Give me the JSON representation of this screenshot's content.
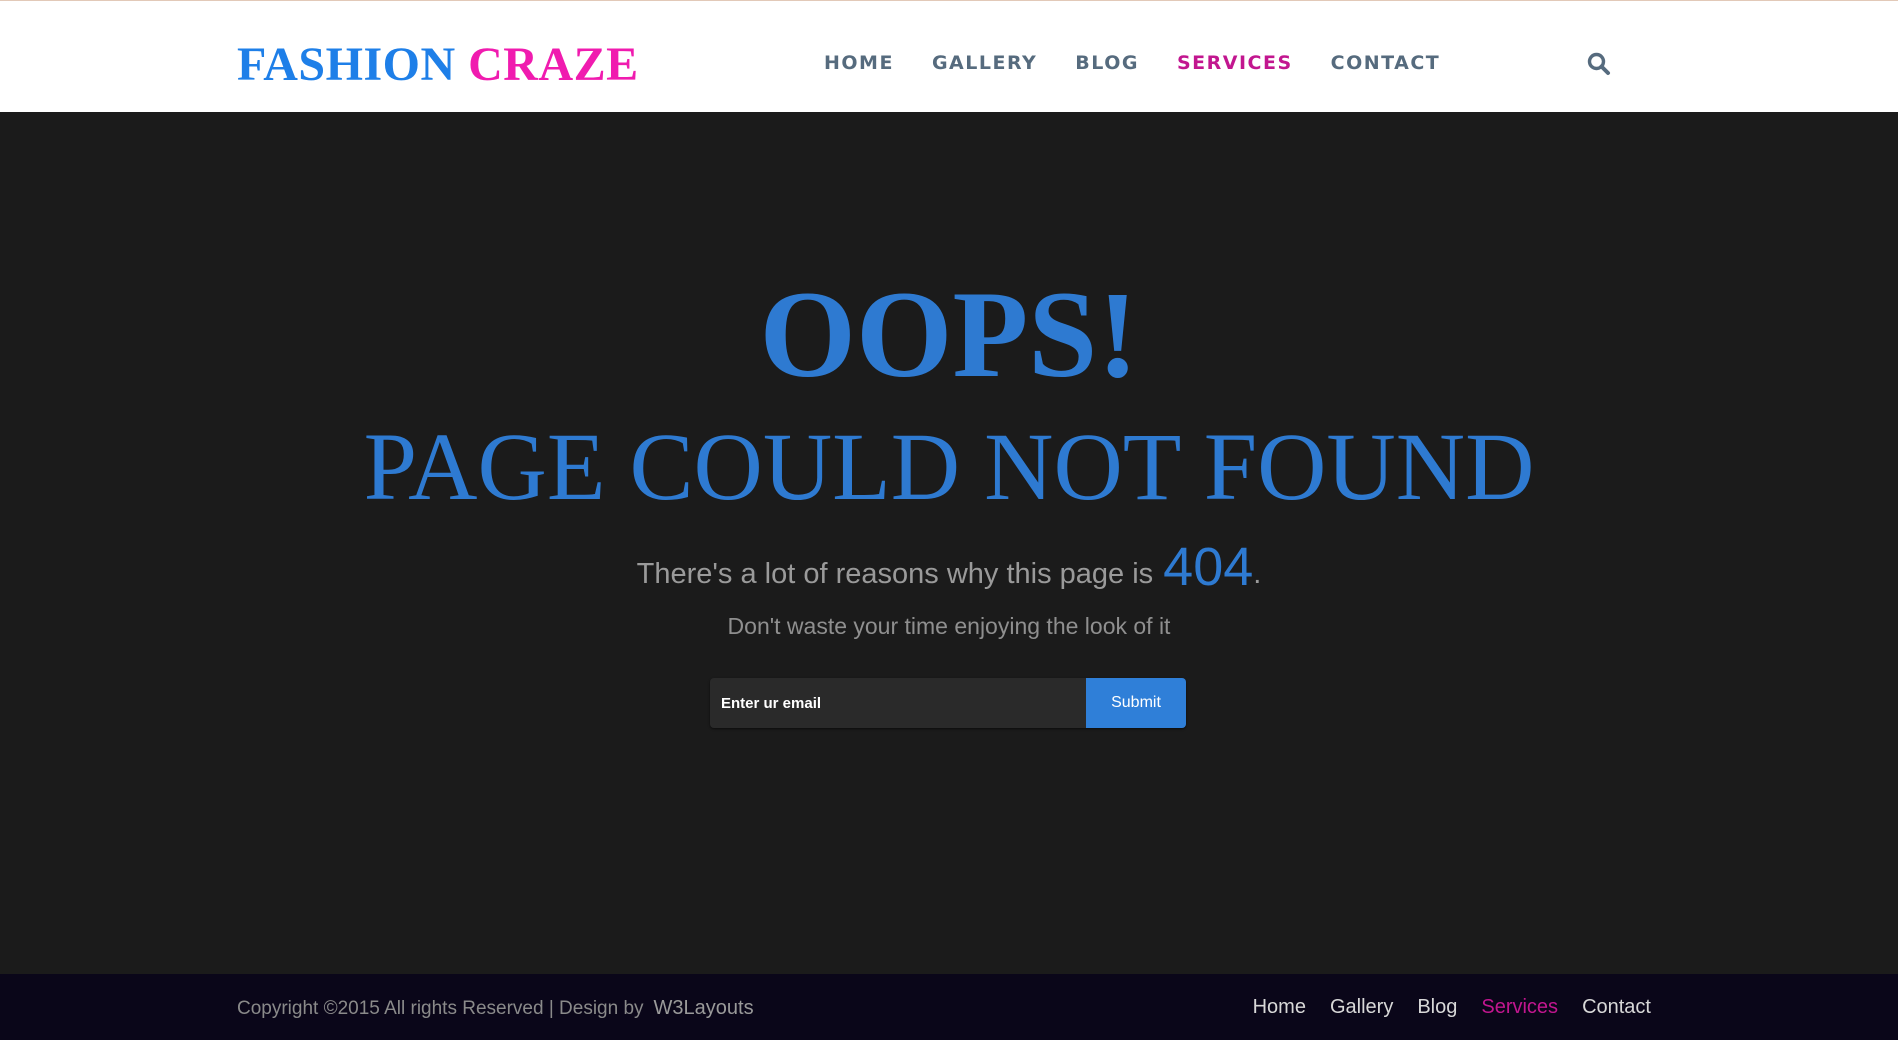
{
  "header": {
    "logo": {
      "part1": "FASHION",
      "part2": "CRAZE"
    },
    "nav": [
      {
        "label": "HOME",
        "active": false
      },
      {
        "label": "GALLERY",
        "active": false
      },
      {
        "label": "BLOG",
        "active": false
      },
      {
        "label": "SERVICES",
        "active": true
      },
      {
        "label": "CONTACT",
        "active": false
      }
    ],
    "search_icon": "search-icon"
  },
  "main": {
    "heading": "OOPS!",
    "subheading": "PAGE COULD NOT FOUND",
    "reasons_text": "There's a lot of reasons why this page is",
    "error_code": "404",
    "reasons_suffix": ".",
    "tagline": "Don't waste your time enjoying the look of it",
    "subscribe": {
      "placeholder": "Enter ur email",
      "button_label": "Submit"
    }
  },
  "footer": {
    "copyright": "Copyright ©2015 All rights Reserved | Design by",
    "designer_link": "W3Layouts",
    "nav": [
      {
        "label": "Home",
        "active": false
      },
      {
        "label": "Gallery",
        "active": false
      },
      {
        "label": "Blog",
        "active": false
      },
      {
        "label": "Services",
        "active": true
      },
      {
        "label": "Contact",
        "active": false
      }
    ]
  },
  "colors": {
    "logo_blue": "#1e7fe8",
    "logo_pink": "#f01baf",
    "accent_blue": "#2e7ad1",
    "active_nav": "#c2168f",
    "background": "#1b1b1b",
    "footer_bg": "#0a0619"
  }
}
